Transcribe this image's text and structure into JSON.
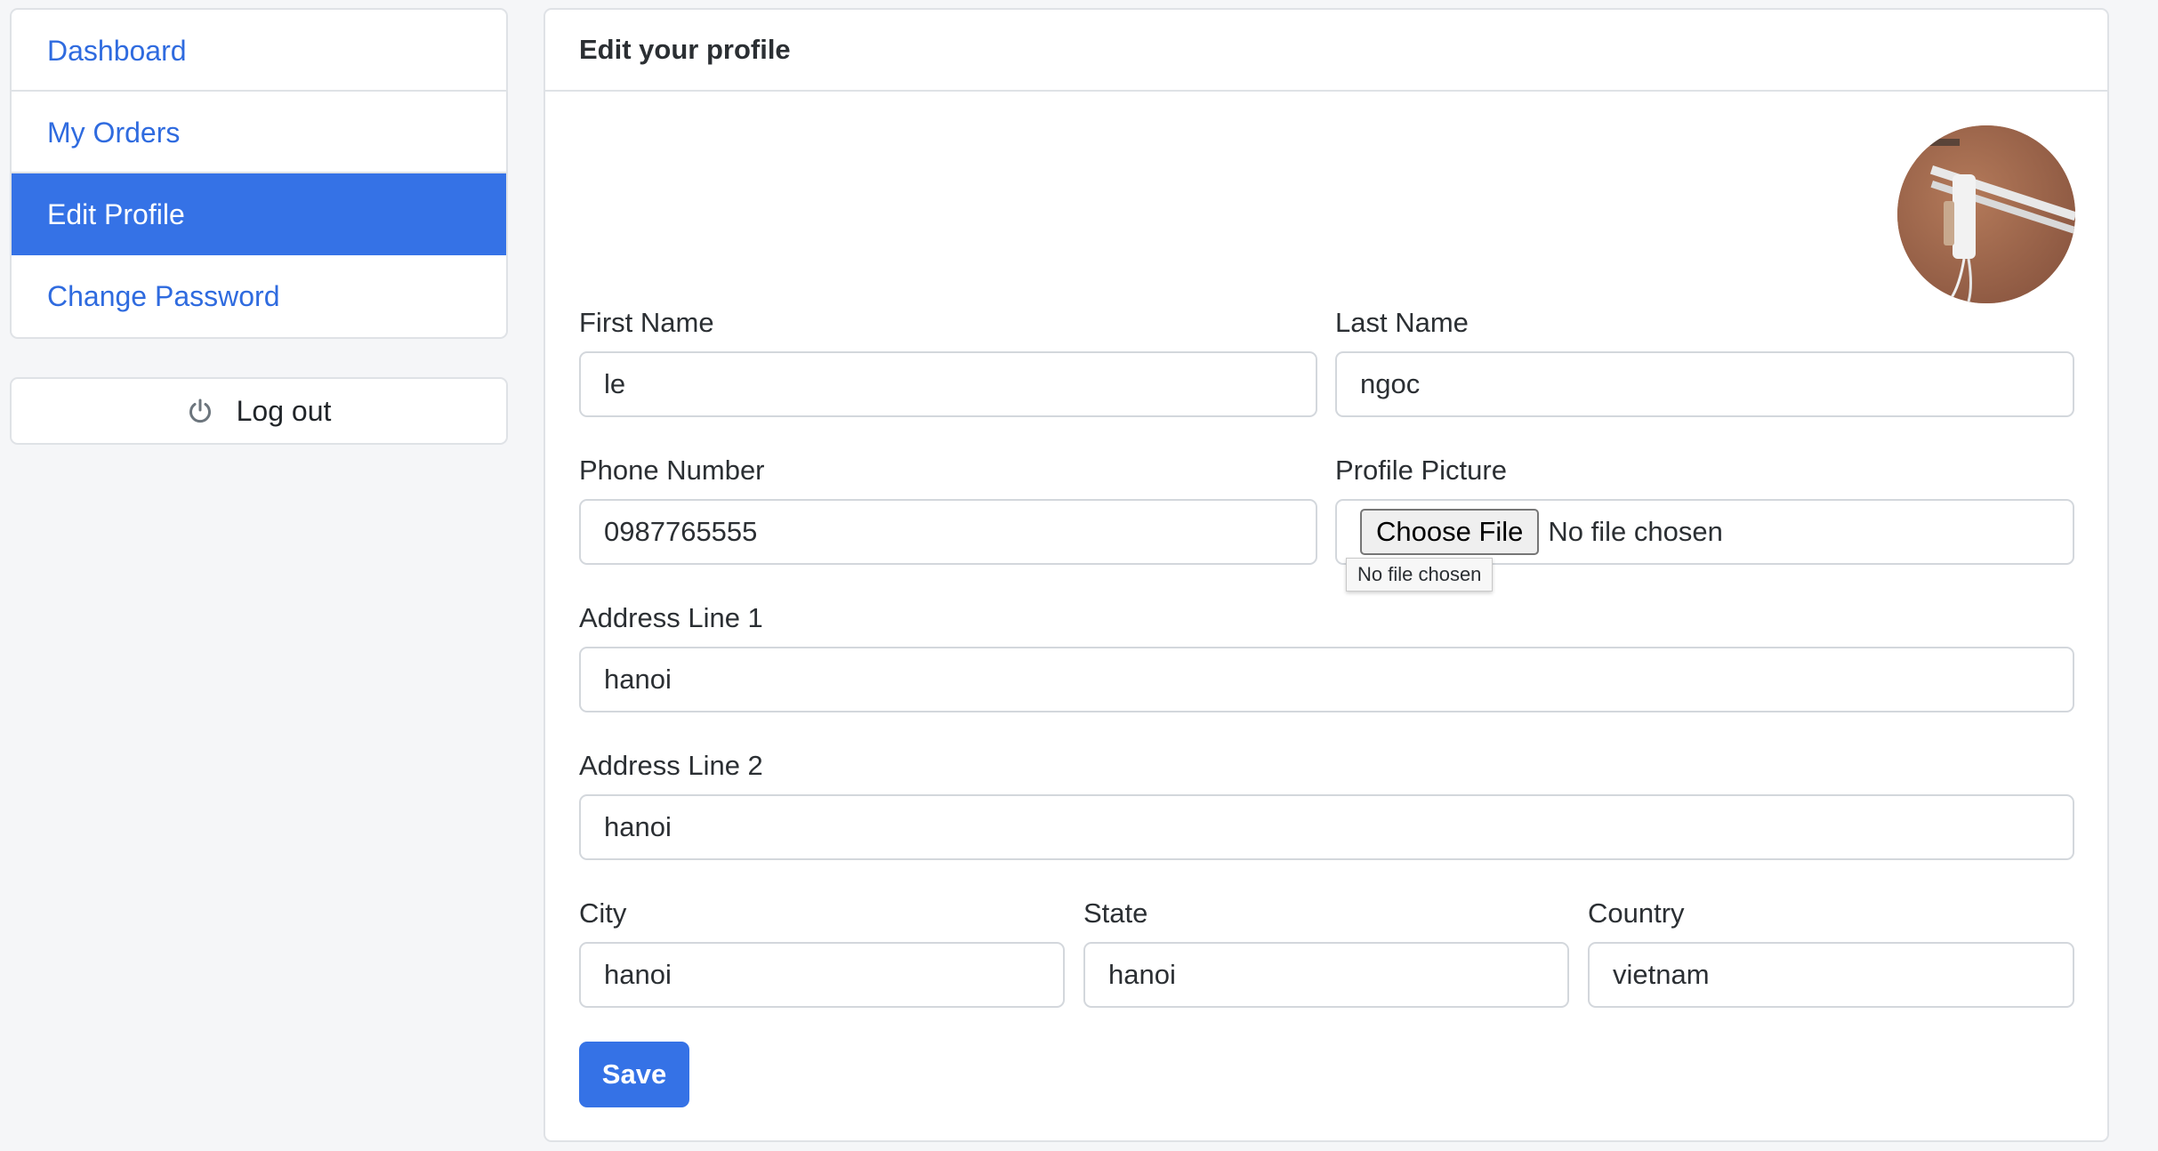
{
  "sidebar": {
    "items": [
      {
        "label": "Dashboard"
      },
      {
        "label": "My Orders"
      },
      {
        "label": "Edit Profile"
      },
      {
        "label": "Change Password"
      }
    ],
    "logout_label": "Log out"
  },
  "profile": {
    "header_title": "Edit your profile",
    "avatar_alt": "profile picture",
    "first_name": {
      "label": "First Name",
      "value": "le"
    },
    "last_name": {
      "label": "Last Name",
      "value": "ngoc"
    },
    "phone": {
      "label": "Phone Number",
      "value": "0987765555"
    },
    "picture": {
      "label": "Profile Picture",
      "button": "Choose File",
      "status": "No file chosen",
      "tooltip": "No file chosen"
    },
    "address1": {
      "label": "Address Line 1",
      "value": "hanoi"
    },
    "address2": {
      "label": "Address Line 2",
      "value": "hanoi"
    },
    "city": {
      "label": "City",
      "value": "hanoi"
    },
    "state": {
      "label": "State",
      "value": "hanoi"
    },
    "country": {
      "label": "Country",
      "value": "vietnam"
    },
    "save_label": "Save"
  },
  "colors": {
    "accent": "#3572e6",
    "link": "#2f6bdf",
    "border": "#dfe2e6",
    "background": "#f5f6f8"
  }
}
